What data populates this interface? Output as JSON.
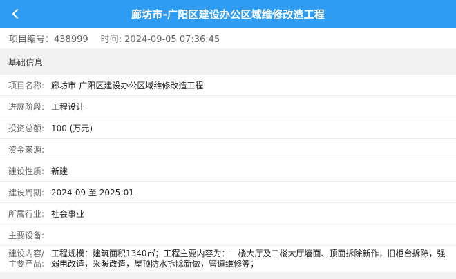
{
  "header": {
    "title": "廊坊市-广阳区建设办公区域维修改造工程",
    "back_icon": "chevron-left-icon"
  },
  "meta": {
    "project_no": "项目编号：438999",
    "time": "时间: 2024-09-05 07:36:45"
  },
  "section": {
    "title": "基础信息"
  },
  "fields": [
    {
      "label": "项目名称:",
      "value": "廊坊市-广阳区建设办公区域维修改造工程"
    },
    {
      "label": "进展阶段:",
      "value": "工程设计"
    },
    {
      "label": "投资总额:",
      "value": "100 (万元)"
    },
    {
      "label": "资金来源:",
      "value": ""
    },
    {
      "label": "建设性质:",
      "value": "新建"
    },
    {
      "label": "建设周期:",
      "value": "2024-09 至 2025-01"
    },
    {
      "label": "所属行业:",
      "value": "社会事业"
    },
    {
      "label": "主要设备:",
      "value": ""
    },
    {
      "label": "建设内容/主要产品:",
      "value": "工程规模：建筑面积1340㎡；工程主要内容为：一楼大厅及二楼大厅墙面、顶面拆除新作，旧柜台拆除，强弱电改造，采暖改造，屋顶防水拆除新做，管道维修等；"
    }
  ],
  "colors": {
    "header_bg": "#2f9cf3",
    "page_bg": "#f2f2f2"
  }
}
